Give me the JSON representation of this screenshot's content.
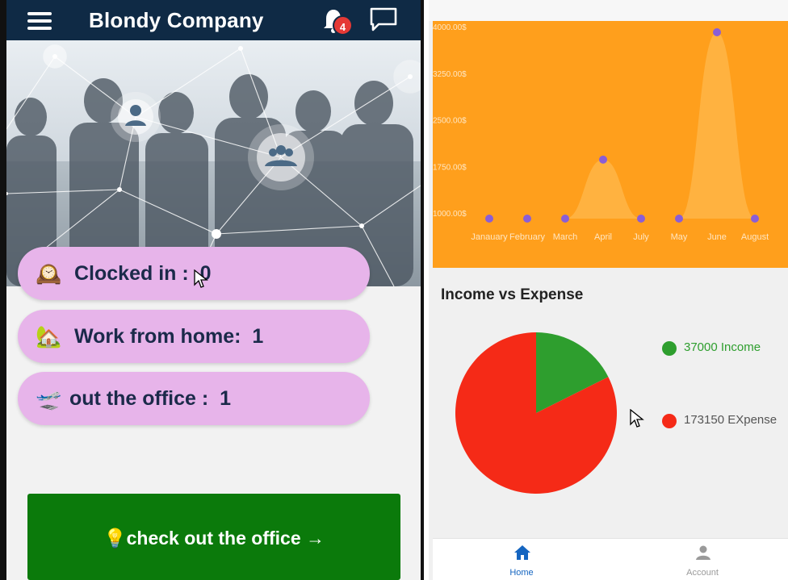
{
  "left": {
    "header": {
      "title": "Blondy Company",
      "notification_count": "4",
      "icons": [
        "menu-icon",
        "bell-icon",
        "chat-icon"
      ],
      "background_color": "#0f2a45"
    },
    "status_cards": [
      {
        "emoji": "🕰️",
        "label": "Clocked in :  0"
      },
      {
        "emoji": "🏡",
        "label": "Work from home:  1"
      },
      {
        "emoji": "🛫",
        "label": "out the office :  1"
      }
    ],
    "checkout_button": {
      "emoji": "💡",
      "label": "check out the office →",
      "color": "#0b7a0b"
    }
  },
  "right": {
    "chart_data": {
      "type": "area",
      "categories": [
        "Janauary",
        "February",
        "March",
        "April",
        "July",
        "May",
        "June",
        "August"
      ],
      "values": [
        1000,
        1000,
        1000,
        1950,
        1000,
        1000,
        4000,
        1000
      ],
      "y_ticks": [
        "1000.00$",
        "1750.00$",
        "2500.00$",
        "3250.00$",
        "4000.00$"
      ],
      "ylim": [
        1000,
        4000
      ],
      "background_color": "#ff9f1c",
      "point_color": "#8a5ed6"
    },
    "pie_section": {
      "title": "Income vs Expense",
      "chart_data": {
        "type": "pie",
        "slices": [
          {
            "label": "37000 Income",
            "value": 37000,
            "color": "#2e9e2e"
          },
          {
            "label": "173150 EXpense",
            "value": 173150,
            "color": "#f52a17"
          }
        ]
      }
    },
    "bottom_nav": {
      "items": [
        {
          "label": "Home",
          "icon": "home-icon",
          "active": true
        },
        {
          "label": "Account",
          "icon": "account-icon",
          "active": false
        }
      ],
      "active_color": "#1565c0",
      "inactive_color": "#9a9a9a"
    }
  }
}
